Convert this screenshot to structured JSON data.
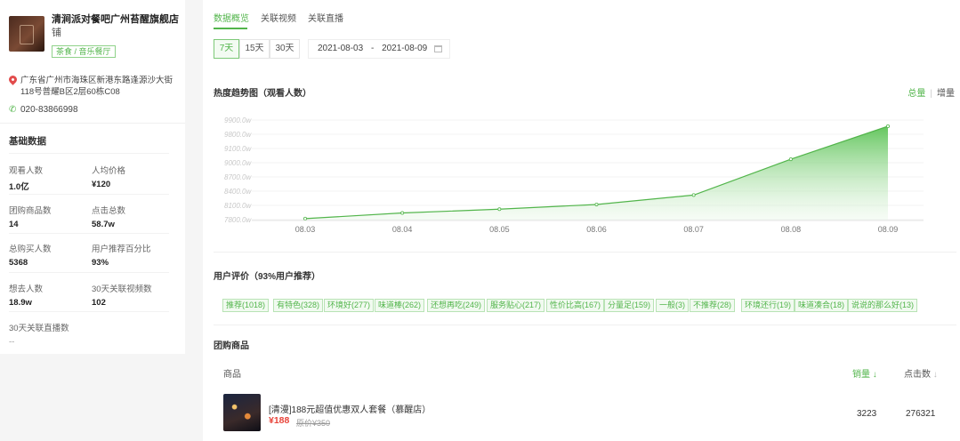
{
  "store": {
    "name": "清涧派对餐吧广州苔醒旗舰店",
    "name_line2": "铺",
    "tag": "茶食 / 音乐餐厅",
    "address": "广东省广州市海珠区新港东路逢源沙大街118号普耀B区2层60栋C08",
    "phone": "020-83866998"
  },
  "basic": {
    "title": "基础数据",
    "stats": [
      {
        "label": "观看人数",
        "value": "1.0亿"
      },
      {
        "label": "人均价格",
        "value": "¥120"
      },
      {
        "label": "团购商品数",
        "value": "14"
      },
      {
        "label": "点击总数",
        "value": "58.7w"
      },
      {
        "label": "总购买人数",
        "value": "5368"
      },
      {
        "label": "用户推荐百分比",
        "value": "93%"
      },
      {
        "label": "想去人数",
        "value": "18.9w"
      },
      {
        "label": "30天关联视频数",
        "value": "102"
      },
      {
        "label": "30天关联直播数",
        "value": "--"
      }
    ]
  },
  "tabs": [
    "数据概览",
    "关联视频",
    "关联直播"
  ],
  "range": {
    "options": [
      "7天",
      "15天",
      "30天"
    ],
    "active": "7天"
  },
  "date_range": {
    "start": "2021-08-03",
    "sep": "-",
    "end": "2021-08-09"
  },
  "chart_section": {
    "title": "热度趋势图（观看人数）",
    "toggle_total": "总量",
    "toggle_incr": "增量"
  },
  "chart_data": {
    "type": "area",
    "title": "",
    "categories": [
      "08.03",
      "08.04",
      "08.05",
      "08.06",
      "08.07",
      "08.08",
      "08.09"
    ],
    "y_ticks": [
      "9900.0w",
      "9800.0w",
      "9100.0w",
      "9000.0w",
      "8700.0w",
      "8400.0w",
      "8100.0w",
      "7800.0w"
    ],
    "values": [
      0.02,
      0.08,
      0.12,
      0.17,
      0.27,
      0.65,
      1.0
    ],
    "fill_color": "#7ed37a",
    "line_color": "#52b54b"
  },
  "evaluation": {
    "title": "用户评价（93%用户推荐）",
    "tags": [
      "推荐(1018)",
      "有特色(328)",
      "环境好(277)",
      "味道棒(262)",
      "还想再吃(249)",
      "服务贴心(217)",
      "性价比高(167)",
      "分量足(159)",
      "一般(3)",
      "不推荐(28)",
      "环境还行(19)",
      "味道凑合(18)",
      "说说的那么好(13)"
    ]
  },
  "group": {
    "title": "团购商品",
    "col_product": "商品",
    "col_sales": "销量",
    "col_clicks": "点击数",
    "items": [
      {
        "name": "[清漫]188元超值优惠双人套餐（慕醒店）",
        "price": "¥188",
        "original_price": "原价¥350",
        "sales": "3223",
        "clicks": "276321"
      }
    ]
  },
  "colors": {
    "accent": "#52b54b",
    "price": "#e8443a"
  }
}
